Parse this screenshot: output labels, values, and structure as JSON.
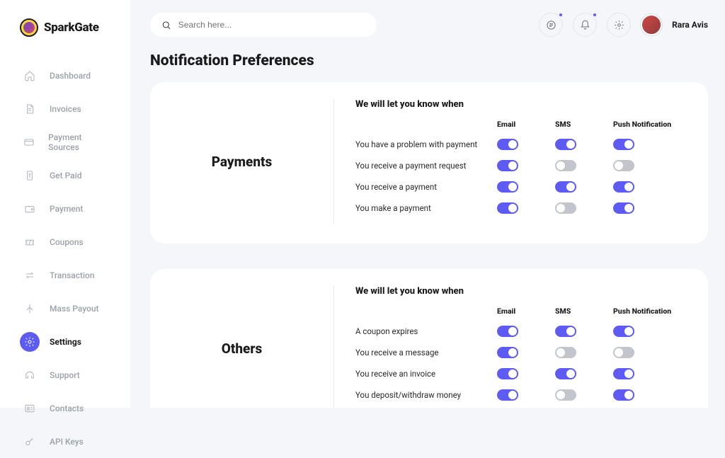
{
  "brand": "SparkGate",
  "search": {
    "placeholder": "Search here..."
  },
  "user": {
    "name": "Rara Avis"
  },
  "nav": [
    {
      "label": "Dashboard",
      "icon": "home"
    },
    {
      "label": "Invoices",
      "icon": "file"
    },
    {
      "label": "Payment Sources",
      "icon": "card"
    },
    {
      "label": "Get Paid",
      "icon": "receipt"
    },
    {
      "label": "Payment",
      "icon": "wallet"
    },
    {
      "label": "Coupons",
      "icon": "ticket"
    },
    {
      "label": "Transaction",
      "icon": "swap"
    },
    {
      "label": "Mass Payout",
      "icon": "branches"
    },
    {
      "label": "Settings",
      "icon": "gear",
      "active": true
    },
    {
      "label": "Support",
      "icon": "headset"
    },
    {
      "label": "Contacts",
      "icon": "idcard"
    },
    {
      "label": "API  Keys",
      "icon": "key"
    }
  ],
  "page_title": "Notification Preferences",
  "section_heading": "We will let you know when",
  "columns": [
    "Email",
    "SMS",
    "Push Notification"
  ],
  "sections": [
    {
      "title": "Payments",
      "rows": [
        {
          "label": "You have a problem with payment",
          "email": true,
          "sms": true,
          "push": true
        },
        {
          "label": "You receive a payment request",
          "email": true,
          "sms": false,
          "push": false
        },
        {
          "label": "You receive a payment",
          "email": true,
          "sms": true,
          "push": true
        },
        {
          "label": "You make a payment",
          "email": true,
          "sms": false,
          "push": true
        }
      ]
    },
    {
      "title": "Others",
      "rows": [
        {
          "label": "A coupon expires",
          "email": true,
          "sms": true,
          "push": true
        },
        {
          "label": "You receive a message",
          "email": true,
          "sms": false,
          "push": false
        },
        {
          "label": "You receive an invoice",
          "email": true,
          "sms": true,
          "push": true
        },
        {
          "label": "You deposit/withdraw money",
          "email": true,
          "sms": false,
          "push": true
        }
      ]
    }
  ]
}
